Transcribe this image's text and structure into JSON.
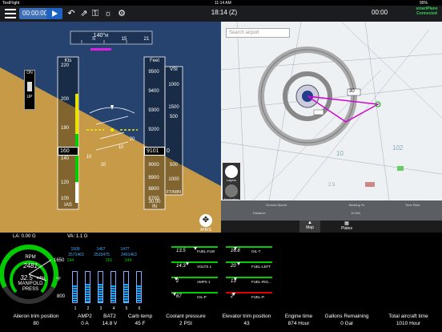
{
  "status_bar": {
    "carrier": "TestFlight",
    "time": "11:14 AM",
    "battery": "95%"
  },
  "toolbar": {
    "timer_value": "00:00:00",
    "clock": "18:14 (Z)",
    "timer2": "00:00",
    "smartplane_line1": "smartPlane",
    "smartplane_line2": "Connected"
  },
  "pfd": {
    "heading": "140°",
    "heading_unit": "M",
    "heading_ticks": [
      "S",
      "15",
      "21"
    ],
    "onup_on": "ON",
    "onup_up": "UP",
    "ias": {
      "label": "Kts",
      "value": "160",
      "footer": "IAS",
      "ticks": [
        "220",
        "200",
        "180",
        "140",
        "120",
        "100"
      ]
    },
    "altitude": {
      "label": "Feet",
      "value": "9101",
      "footer_value": "30.00",
      "footer_unit": "IN",
      "ticks": [
        "9500",
        "9400",
        "9300",
        "9200",
        "9000",
        "8900",
        "8800",
        "8700"
      ]
    },
    "vsi": {
      "label": "VSI",
      "value": "0",
      "unit": "FT/MIN",
      "ticks": [
        "1000",
        "500",
        "500",
        "1000",
        "1500"
      ]
    },
    "bank_ticks": [
      "10",
      "20",
      "10",
      "20"
    ],
    "ahrs_label": "AHRS"
  },
  "load": {
    "la": "LA: 0.00 G",
    "va": "VA: 1.1 G"
  },
  "map": {
    "search_placeholder": "Search airport",
    "side_label_1": "Layers",
    "side_label_2": "Navigation",
    "info_left": "Ground Speed",
    "info_mid": "Bearing To",
    "info_right": "Time Rem",
    "info_val": "Distance",
    "info_dist": "10 NM",
    "tabs": [
      "Map",
      "Plates"
    ],
    "labels": [
      "30",
      "102",
      "10",
      "2.5"
    ]
  },
  "engine": {
    "rpm_label": "RPM",
    "rpm_value": "2481",
    "mp_value": "32.5",
    "mp_unit": "inHg",
    "mp_label": "MANIFOLD",
    "mp_label2": "PRESS",
    "mp_max": "1650",
    "egt_top": [
      "1509",
      "1467",
      "1477"
    ],
    "egt_bottom": [
      "2571463",
      "2533475",
      "2461463"
    ],
    "cht": [
      "244",
      "251",
      "244"
    ],
    "temp_unit": "°F",
    "scale_low": "800",
    "cylinder_levels": [
      0.55,
      0.6,
      0.6,
      0.55,
      0.6,
      0.55
    ],
    "cylinders": [
      "1",
      "2",
      "3",
      "4",
      "5",
      "6"
    ]
  },
  "secondary": [
    {
      "value": "13.5",
      "label": "FUEL-FLW"
    },
    {
      "value": "16.8",
      "label": "OIL-T"
    },
    {
      "value": "14.3",
      "label": "VOLTS 1"
    },
    {
      "value": "20",
      "label": "FUEL-LEFT"
    },
    {
      "value": "2",
      "label": "AMPS 1"
    },
    {
      "value": "13",
      "label": "FUEL-RIG..."
    },
    {
      "value": "67",
      "label": "OIL-P"
    },
    {
      "value": "2",
      "label": "FUEL-P"
    }
  ],
  "footer": [
    {
      "label": "Aileron trim position",
      "value": "80"
    },
    {
      "label": "AMP2",
      "value": "0 A"
    },
    {
      "label": "BAT2",
      "value": "14.8 V"
    },
    {
      "label": "Carb temp",
      "value": "45 F"
    },
    {
      "label": "Coolant pressure",
      "value": "2 PSI"
    },
    {
      "label": "Elevator trim position",
      "value": "43"
    },
    {
      "label": "Engine time",
      "value": "874 Hour"
    },
    {
      "label": "Gallons Remaining",
      "value": "0 Gal"
    },
    {
      "label": "Total aircraft time",
      "value": "1010 Hour"
    }
  ]
}
